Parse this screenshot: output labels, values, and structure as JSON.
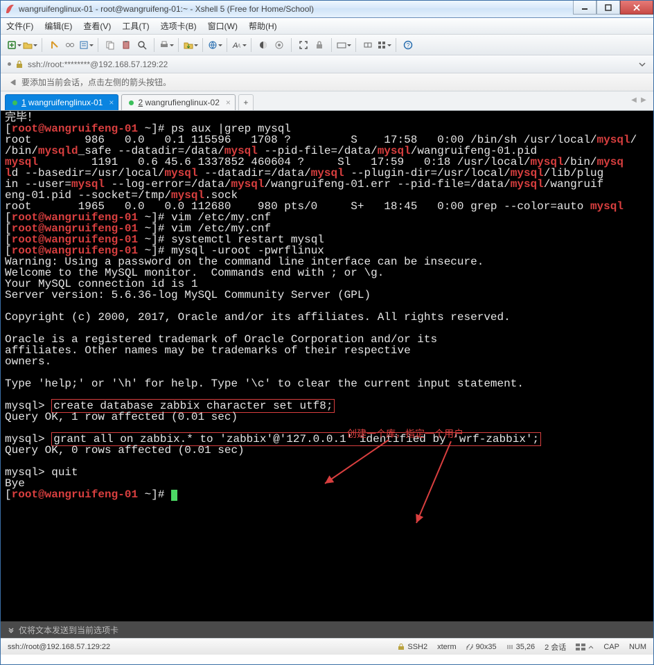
{
  "window": {
    "title": "wangruifenglinux-01 - root@wangruifeng-01:~ - Xshell 5 (Free for Home/School)"
  },
  "menu": {
    "items": [
      "文件(F)",
      "编辑(E)",
      "查看(V)",
      "工具(T)",
      "选项卡(B)",
      "窗口(W)",
      "帮助(H)"
    ]
  },
  "addressbar": {
    "text": "ssh://root:********@192.168.57.129:22"
  },
  "hint": {
    "text": "要添加当前会话，点击左侧的箭头按钮。"
  },
  "tabs": {
    "items": [
      {
        "prefix": "1",
        "label": "wangruifenglinux-01",
        "active": true
      },
      {
        "prefix": "2",
        "label": "wangrufienglinux-02",
        "active": false
      }
    ],
    "add": "+"
  },
  "terminal": {
    "complete": "完毕！",
    "prompt_u": "root@wangruifeng-01",
    "prompt_tail": " ~]# ",
    "ps_cmd": "ps aux |grep mysql",
    "line_root986": "root        986   0.0   0.1 115596   1708 ?         S    17:58   0:00 /bin/sh /usr/local/",
    "mysql": "mysql",
    "mysqld": "mysqld",
    "line_root986_b": "/bin/",
    "slash": "/",
    "safe_line": "_safe --datadir=/data/",
    "pidfile": " --pid-file=/data/",
    "wangpid": "/wangruifeng-01.pid",
    "line1191": "        1191   0.6 45.6 1337852 460604 ?     Sl   17:59   0:18 /usr/local/",
    "bin": "/bin/",
    "mysq": "mysq",
    "ld_base": " --basedir=/usr/local/",
    "l": "l",
    "d": "d",
    "datadir": " --datadir=/data/",
    "plugin": " --plugin-dir=/usr/local/",
    "libplug": "/lib/plug",
    "in_user": "in --user=",
    "logerr": " --log-error=/data/",
    "wangerr": "/wangruifeng-01.err --pid-file=/data/",
    "wangruif": "/wangruif",
    "eng01pid": "eng-01.pid --socket=/tmp/",
    "sock": ".sock",
    "line1965": "root       1965   0.0   0.0 112680    980 pts/0     S+   18:45   0:00 grep --color=auto ",
    "vim1": "vim /etc/my.cnf",
    "vim2": "vim /etc/my.cnf",
    "sysctl": "systemctl restart mysql",
    "mysqlcmd": "mysql -uroot -pwrflinux",
    "warn": "Warning: Using a password on the command line interface can be insecure.",
    "welcome": "Welcome to the MySQL monitor.  Commands end with ; or \\g.",
    "connid": "Your MySQL connection id is 1",
    "server": "Server version: 5.6.36-log MySQL Community Server (GPL)",
    "copyright": "Copyright (c) 2000, 2017, Oracle and/or its affiliates. All rights reserved.",
    "oracle1": "Oracle is a registered trademark of Oracle Corporation and/or its",
    "oracle2": "affiliates. Other names may be trademarks of their respective",
    "owners": "owners.",
    "help": "Type 'help;' or '\\h' for help. Type '\\c' to clear the current input statement.",
    "mysqlp": "mysql> ",
    "createdb": "create database zabbix character set utf8;",
    "qok1": "Query OK, 1 row affected (0.01 sec)",
    "grant": "grant all on zabbix.* to 'zabbix'@'127.0.0.1' identified by 'wrf-zabbix';",
    "qok2": "Query OK, 0 rows affected (0.01 sec)",
    "quit": "quit",
    "bye": "Bye",
    "annotation": "创建一个库，指定一个用户"
  },
  "bottomstrip": {
    "text": "仅将文本发送到当前选项卡"
  },
  "statusbar": {
    "left": "ssh://root@192.168.57.129:22",
    "ssh": "SSH2",
    "term": "xterm",
    "size": "90x35",
    "pos": "35,26",
    "sessions": "2 会话",
    "cap": "CAP",
    "num": "NUM"
  }
}
